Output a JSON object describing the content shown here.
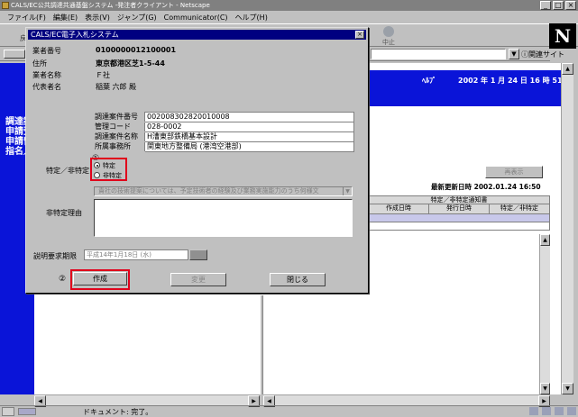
{
  "browser": {
    "title": "CALS/EC公共調達共通基盤システム -発注者クライアント - Netscape",
    "menu": [
      "ファイル(F)",
      "編集(E)",
      "表示(V)",
      "ジャンプ(G)",
      "Communicator(C)",
      "ヘルプ(H)"
    ],
    "toolbar_fragment": "戻",
    "stop_label": "中止",
    "related_sites": "関連サイト",
    "status_message": "ドキュメント: 完了。"
  },
  "left_nav": [
    "調達案",
    "申請受",
    "申請留",
    "指名／"
  ],
  "page": {
    "help": "ﾍﾙﾌﾟ",
    "datetime": "2002 年  1 月 24 日  16 時 51 分",
    "resort_button": "再表示",
    "last_updated": "最新更新日時 2002.01.24 16:50",
    "table": {
      "group_header": "特定／非特定通知書",
      "columns": [
        "作成日時",
        "発行日時",
        "特定／非特定"
      ]
    }
  },
  "dialog": {
    "title": "CALS/EC電子入札システム",
    "vendor": {
      "labels": [
        "業者番号",
        "住所",
        "業者名称",
        "代表者名"
      ],
      "values": [
        "0100000012100001",
        "東京都港区芝1-5-44",
        "Ｆ社",
        "稲葉 六郎  殿"
      ]
    },
    "details": [
      {
        "key": "調達案件番号",
        "value": "002008302820010008"
      },
      {
        "key": "管理コード",
        "value": "028-0002"
      },
      {
        "key": "調達案件名称",
        "value": "H漕東部鉄橋基本設計"
      },
      {
        "key": "所属事務所",
        "value": "関東地方整備局 (港湾空港部)"
      }
    ],
    "specific_label": "特定／非特定",
    "radio_options": [
      "特定",
      "非特定"
    ],
    "selected_option": "特定",
    "reason_select": "貴社の技術提案については、予定技術者の経験及び業務実施能力のうち何様文",
    "reason_label": "非特定理由",
    "deadline_label": "説明要求期限",
    "deadline_value": "平成14年1月18日 (水)",
    "buttons": {
      "create": "作成",
      "change": "変更",
      "close": "閉じる"
    },
    "step1": "①",
    "step2": "②"
  }
}
